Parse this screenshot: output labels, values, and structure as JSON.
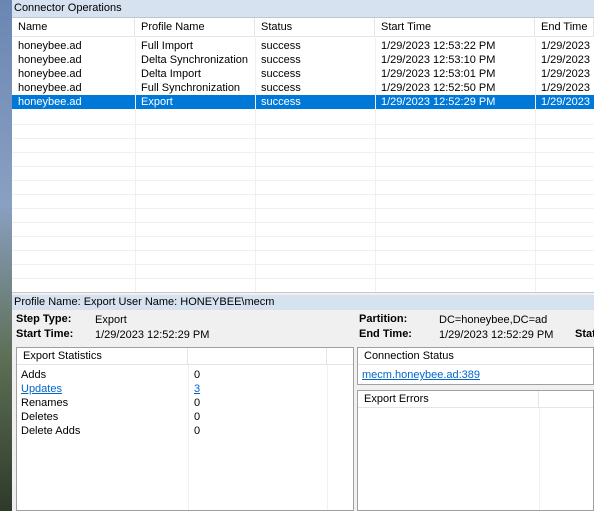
{
  "window": {
    "title": "Connector Operations"
  },
  "operations": {
    "columns": [
      "Name",
      "Profile Name",
      "Status",
      "Start Time",
      "End Time"
    ],
    "rows": [
      {
        "name": "honeybee.ad",
        "profile": "Full Import",
        "status": "success",
        "start": "1/29/2023 12:53:22 PM",
        "end": "1/29/2023"
      },
      {
        "name": "honeybee.ad",
        "profile": "Delta Synchronization",
        "status": "success",
        "start": "1/29/2023 12:53:10 PM",
        "end": "1/29/2023"
      },
      {
        "name": "honeybee.ad",
        "profile": "Delta Import",
        "status": "success",
        "start": "1/29/2023 12:53:01 PM",
        "end": "1/29/2023"
      },
      {
        "name": "honeybee.ad",
        "profile": "Full Synchronization",
        "status": "success",
        "start": "1/29/2023 12:52:50 PM",
        "end": "1/29/2023"
      },
      {
        "name": "honeybee.ad",
        "profile": "Export",
        "status": "success",
        "start": "1/29/2023 12:52:29 PM",
        "end": "1/29/2023"
      }
    ],
    "selected_index": 4
  },
  "details": {
    "header": "Profile Name: Export  User Name: HONEYBEE\\mecm",
    "step_type_label": "Step Type:",
    "step_type": "Export",
    "start_time_label": "Start Time:",
    "start_time": "1/29/2023 12:52:29 PM",
    "partition_label": "Partition:",
    "partition": "DC=honeybee,DC=ad",
    "end_time_label": "End Time:",
    "end_time": "1/29/2023 12:52:29 PM",
    "status_label_partial": "Stat"
  },
  "export_statistics": {
    "header": "Export Statistics",
    "rows": [
      {
        "label": "Adds",
        "value": "0",
        "link": false
      },
      {
        "label": "Updates",
        "value": "3",
        "link": true
      },
      {
        "label": "Renames",
        "value": "0",
        "link": false
      },
      {
        "label": "Deletes",
        "value": "0",
        "link": false
      },
      {
        "label": "Delete Adds",
        "value": "0",
        "link": false
      }
    ]
  },
  "connection_status": {
    "header": "Connection Status",
    "link": "mecm.honeybee.ad:389"
  },
  "export_errors": {
    "header": "Export Errors"
  }
}
